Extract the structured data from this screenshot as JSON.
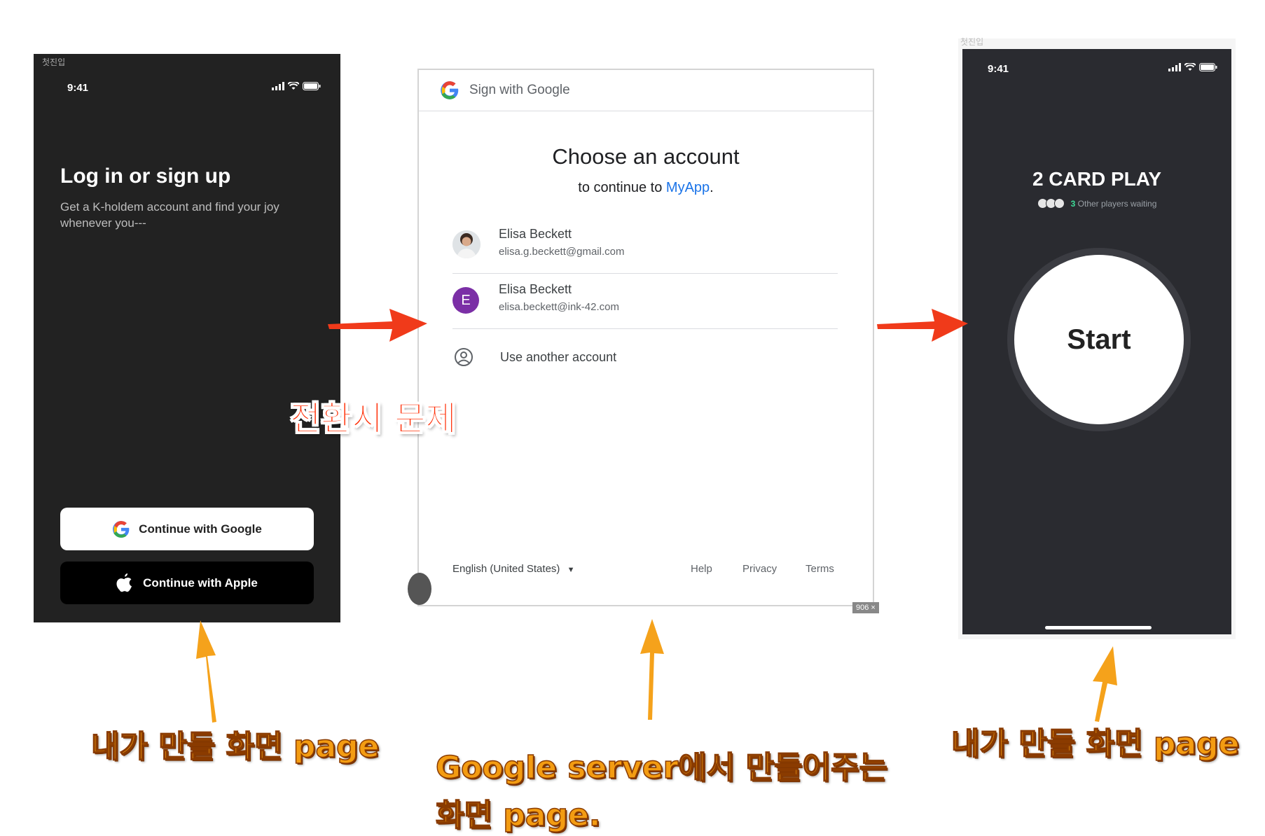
{
  "login_screen": {
    "top_label": "첫진입",
    "status_time": "9:41",
    "title": "Log in or sign up",
    "subtitle": "Get a K-holdem account and find your joy whenever you---",
    "google_button": "Continue with Google",
    "apple_button": "Continue with Apple"
  },
  "google_screen": {
    "header_title": "Sign with Google",
    "heading": "Choose an account",
    "continue_prefix": "to continue to",
    "app_name": "MyApp",
    "continue_suffix": ".",
    "accounts": [
      {
        "name": "Elisa Beckett",
        "email": "elisa.g.beckett@gmail.com",
        "avatar": "photo"
      },
      {
        "name": "Elisa Beckett",
        "email": "elisa.beckett@ink-42.com",
        "avatar": "E"
      }
    ],
    "use_another": "Use another account",
    "language": "English (United States)",
    "footer_links": [
      "Help",
      "Privacy",
      "Terms"
    ],
    "size_badge": "906 ×",
    "accent_color": "#1a73e8"
  },
  "game_screen": {
    "top_label": "첫진입",
    "status_time": "9:41",
    "title": "2 CARD PLAY",
    "waiting_count": "3",
    "waiting_text": "Other players waiting",
    "start_button": "Start",
    "accent_color": "#3ddc97"
  },
  "annotations": {
    "transition_issue": "전환시 문제",
    "left_caption": "내가 만들 화면 page",
    "middle_caption_line1": "Google server에서 만들어주는",
    "middle_caption_line2": "화면 page.",
    "right_caption": "내가 만들 화면 page",
    "arrow_red_color": "#f03a1a",
    "arrow_orange_color": "#f5a21b"
  }
}
